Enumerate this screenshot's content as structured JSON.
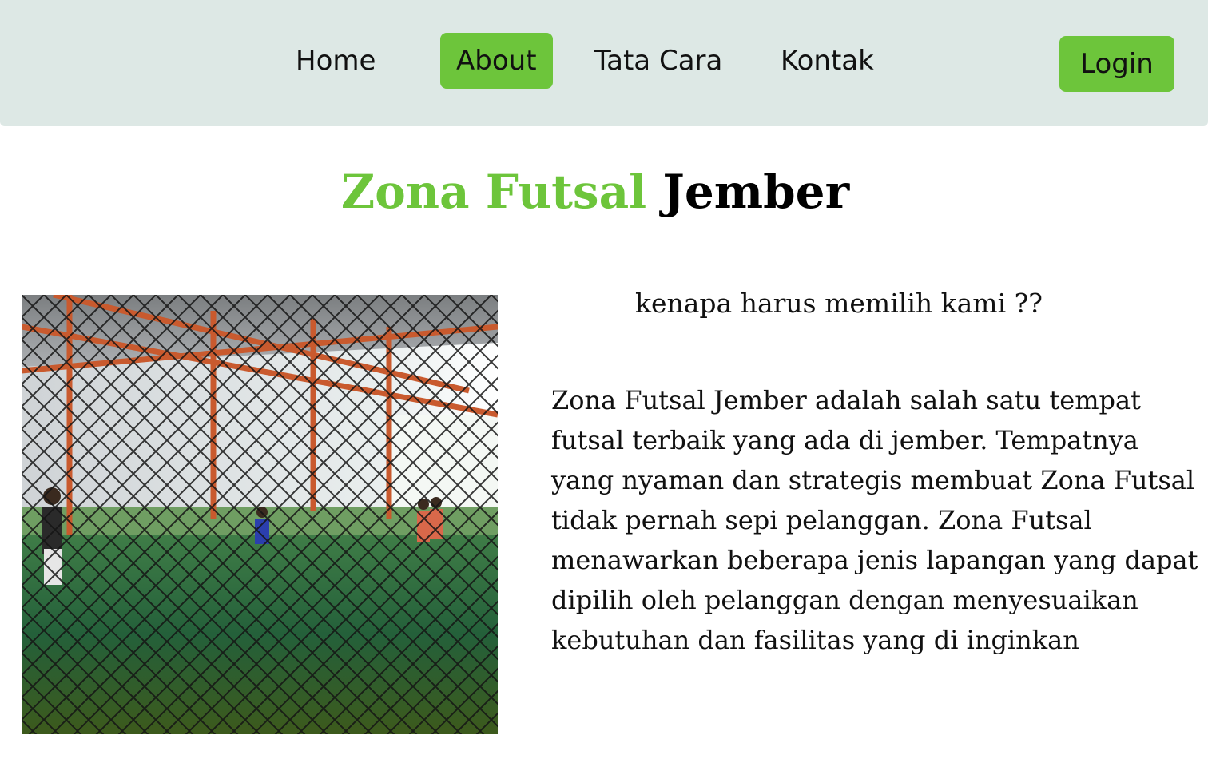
{
  "nav": {
    "items": [
      {
        "label": "Home"
      },
      {
        "label": "About",
        "active": true
      },
      {
        "label": "Tata Cara"
      },
      {
        "label": "Kontak"
      }
    ],
    "login_label": "Login",
    "bar_color": "#dde8e5",
    "accent_color": "#6dc53b"
  },
  "hero": {
    "title_accent": "Zona Futsal",
    "title_rest": "Jember"
  },
  "about": {
    "subheading": "kenapa harus memilih kami ??",
    "description": "Zona Futsal Jember adalah salah satu tempat futsal terbaik yang ada di jember. Tempatnya yang nyaman dan strategis membuat Zona Futsal tidak pernah sepi pelanggan. Zona Futsal menawarkan beberapa jenis lapangan yang dapat dipilih oleh pelanggan dengan menyesuaikan kebutuhan dan fasilitas yang di inginkan"
  },
  "image": {
    "subject": "indoor futsal court photo"
  }
}
